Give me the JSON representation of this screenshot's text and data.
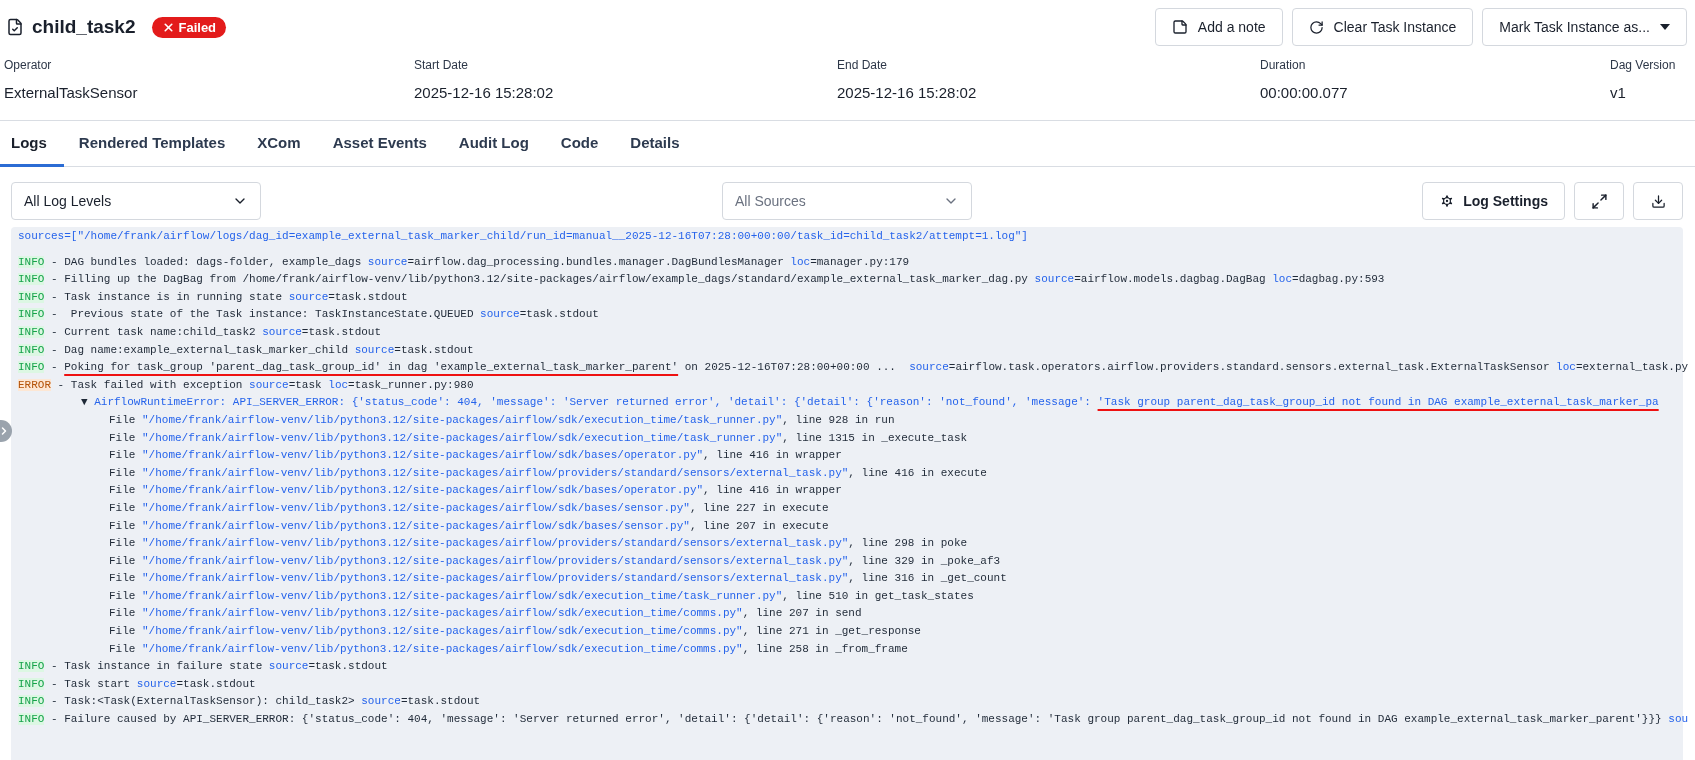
{
  "task": {
    "title": "child_task2",
    "status": {
      "label": "Failed",
      "kind": "failed"
    }
  },
  "actions": [
    {
      "label": "Add a note",
      "kind": "note"
    },
    {
      "label": "Clear Task Instance",
      "kind": "clear"
    },
    {
      "label": "Mark Task Instance as...",
      "kind": "menu"
    }
  ],
  "details": [
    {
      "label": "Operator",
      "value": "ExternalTaskSensor"
    },
    {
      "label": "Start Date",
      "value": "2025-12-16 15:28:02"
    },
    {
      "label": "End Date",
      "value": "2025-12-16 15:28:02"
    },
    {
      "label": "Duration",
      "value": "00:00:00.077"
    },
    {
      "label": "Dag Version",
      "value": "v1"
    }
  ],
  "tabs": [
    {
      "label": "Logs",
      "selected": true
    },
    {
      "label": "Rendered Templates",
      "selected": false
    },
    {
      "label": "XCom",
      "selected": false
    },
    {
      "label": "Asset Events",
      "selected": false
    },
    {
      "label": "Audit Log",
      "selected": false
    },
    {
      "label": "Code",
      "selected": false
    },
    {
      "label": "Details",
      "selected": false
    }
  ],
  "log_toolbar": {
    "level_filter": {
      "value": "All Log Levels"
    },
    "source_filter": {
      "placeholder": "All Sources"
    },
    "buttons": [
      {
        "label": "Log Settings",
        "kind": "settings"
      },
      {
        "kind": "fullscreen"
      },
      {
        "kind": "download"
      }
    ]
  },
  "log": {
    "lines": [
      {
        "kind": "header",
        "segments": [
          {
            "text": "sources=[\"/home/frank/airflow/logs/dag_id=example_external_task_marker_child/run_id=manual__2025-12-16T07:28:00+00:00/task_id=child_task2/attempt=1.log\"]",
            "kind": "link"
          }
        ]
      },
      {
        "kind": "entry",
        "segments": [
          {
            "text": "INFO",
            "kind": "info"
          },
          {
            "text": " - DAG bundles loaded: dags-folder, example_dags ",
            "kind": "plain"
          },
          {
            "text": "source",
            "kind": "link"
          },
          {
            "text": "=airflow.dag_processing.bundles.manager.DagBundlesManager ",
            "kind": "plain"
          },
          {
            "text": "loc",
            "kind": "link"
          },
          {
            "text": "=manager.py:179",
            "kind": "plain"
          }
        ]
      },
      {
        "kind": "entry",
        "segments": [
          {
            "text": "INFO",
            "kind": "info"
          },
          {
            "text": " - Filling up the DagBag from /home/frank/airflow-venv/lib/python3.12/site-packages/airflow/example_dags/standard/example_external_task_marker_dag.py ",
            "kind": "plain"
          },
          {
            "text": "source",
            "kind": "link"
          },
          {
            "text": "=airflow.models.dagbag.DagBag ",
            "kind": "plain"
          },
          {
            "text": "loc",
            "kind": "link"
          },
          {
            "text": "=dagbag.py:593",
            "kind": "plain"
          }
        ]
      },
      {
        "kind": "entry",
        "segments": [
          {
            "text": "INFO",
            "kind": "info"
          },
          {
            "text": " - Task instance is in running state ",
            "kind": "plain"
          },
          {
            "text": "source",
            "kind": "link"
          },
          {
            "text": "=task.stdout",
            "kind": "plain"
          }
        ]
      },
      {
        "kind": "entry",
        "segments": [
          {
            "text": "INFO",
            "kind": "info"
          },
          {
            "text": " -  Previous state of the Task instance: TaskInstanceState.QUEUED ",
            "kind": "plain"
          },
          {
            "text": "source",
            "kind": "link"
          },
          {
            "text": "=task.stdout",
            "kind": "plain"
          }
        ]
      },
      {
        "kind": "entry",
        "segments": [
          {
            "text": "INFO",
            "kind": "info"
          },
          {
            "text": " - Current task name:child_task2 ",
            "kind": "plain"
          },
          {
            "text": "source",
            "kind": "link"
          },
          {
            "text": "=task.stdout",
            "kind": "plain"
          }
        ]
      },
      {
        "kind": "entry",
        "segments": [
          {
            "text": "INFO",
            "kind": "info"
          },
          {
            "text": " - Dag name:example_external_task_marker_child ",
            "kind": "plain"
          },
          {
            "text": "source",
            "kind": "link"
          },
          {
            "text": "=task.stdout",
            "kind": "plain"
          }
        ]
      },
      {
        "kind": "entry",
        "segments": [
          {
            "text": "INFO",
            "kind": "info"
          },
          {
            "text": " - ",
            "kind": "plain"
          },
          {
            "text": "Poking for task_group 'parent_dag_task_group_id' in dag 'example_external_task_marker_parent'",
            "kind": "marked"
          },
          {
            "text": " on 2025-12-16T07:28:00+00:00 ...  ",
            "kind": "plain"
          },
          {
            "text": "source",
            "kind": "link"
          },
          {
            "text": "=airflow.task.operators.airflow.providers.standard.sensors.external_task.ExternalTaskSensor ",
            "kind": "plain"
          },
          {
            "text": "loc",
            "kind": "link"
          },
          {
            "text": "=external_task.py",
            "kind": "plain"
          }
        ]
      },
      {
        "kind": "entry",
        "segments": [
          {
            "text": "ERROR",
            "kind": "error"
          },
          {
            "text": " - Task failed with exception ",
            "kind": "plain"
          },
          {
            "text": "source",
            "kind": "link"
          },
          {
            "text": "=task ",
            "kind": "plain"
          },
          {
            "text": "loc",
            "kind": "link"
          },
          {
            "text": "=task_runner.py:980",
            "kind": "plain"
          }
        ]
      },
      {
        "kind": "exception",
        "segments": [
          {
            "text": "▼ ",
            "kind": "plain"
          },
          {
            "text": "AirflowRuntimeError: API_SERVER_ERROR: {'status_code': 404, 'message': 'Server returned error', 'detail': {'detail': {'reason': 'not_found', 'message': ",
            "kind": "link"
          },
          {
            "text": "'Task group parent_dag_task_group_id not found in DAG example_external_task_marker_pa",
            "kind": "marked-link"
          }
        ]
      },
      {
        "kind": "frame",
        "segments": [
          {
            "text": "File ",
            "kind": "plain"
          },
          {
            "text": "\"/home/frank/airflow-venv/lib/python3.12/site-packages/airflow/sdk/execution_time/task_runner.py\"",
            "kind": "link"
          },
          {
            "text": ", line 928 in run",
            "kind": "plain"
          }
        ]
      },
      {
        "kind": "frame",
        "segments": [
          {
            "text": "File ",
            "kind": "plain"
          },
          {
            "text": "\"/home/frank/airflow-venv/lib/python3.12/site-packages/airflow/sdk/execution_time/task_runner.py\"",
            "kind": "link"
          },
          {
            "text": ", line 1315 in _execute_task",
            "kind": "plain"
          }
        ]
      },
      {
        "kind": "frame",
        "segments": [
          {
            "text": "File ",
            "kind": "plain"
          },
          {
            "text": "\"/home/frank/airflow-venv/lib/python3.12/site-packages/airflow/sdk/bases/operator.py\"",
            "kind": "link"
          },
          {
            "text": ", line 416 in wrapper",
            "kind": "plain"
          }
        ]
      },
      {
        "kind": "frame",
        "segments": [
          {
            "text": "File ",
            "kind": "plain"
          },
          {
            "text": "\"/home/frank/airflow-venv/lib/python3.12/site-packages/airflow/providers/standard/sensors/external_task.py\"",
            "kind": "link"
          },
          {
            "text": ", line 416 in execute",
            "kind": "plain"
          }
        ]
      },
      {
        "kind": "frame",
        "segments": [
          {
            "text": "File ",
            "kind": "plain"
          },
          {
            "text": "\"/home/frank/airflow-venv/lib/python3.12/site-packages/airflow/sdk/bases/operator.py\"",
            "kind": "link"
          },
          {
            "text": ", line 416 in wrapper",
            "kind": "plain"
          }
        ]
      },
      {
        "kind": "frame",
        "segments": [
          {
            "text": "File ",
            "kind": "plain"
          },
          {
            "text": "\"/home/frank/airflow-venv/lib/python3.12/site-packages/airflow/sdk/bases/sensor.py\"",
            "kind": "link"
          },
          {
            "text": ", line 227 in execute",
            "kind": "plain"
          }
        ]
      },
      {
        "kind": "frame",
        "segments": [
          {
            "text": "File ",
            "kind": "plain"
          },
          {
            "text": "\"/home/frank/airflow-venv/lib/python3.12/site-packages/airflow/sdk/bases/sensor.py\"",
            "kind": "link"
          },
          {
            "text": ", line 207 in execute",
            "kind": "plain"
          }
        ]
      },
      {
        "kind": "frame",
        "segments": [
          {
            "text": "File ",
            "kind": "plain"
          },
          {
            "text": "\"/home/frank/airflow-venv/lib/python3.12/site-packages/airflow/providers/standard/sensors/external_task.py\"",
            "kind": "link"
          },
          {
            "text": ", line 298 in poke",
            "kind": "plain"
          }
        ]
      },
      {
        "kind": "frame",
        "segments": [
          {
            "text": "File ",
            "kind": "plain"
          },
          {
            "text": "\"/home/frank/airflow-venv/lib/python3.12/site-packages/airflow/providers/standard/sensors/external_task.py\"",
            "kind": "link"
          },
          {
            "text": ", line 329 in _poke_af3",
            "kind": "plain"
          }
        ]
      },
      {
        "kind": "frame",
        "segments": [
          {
            "text": "File ",
            "kind": "plain"
          },
          {
            "text": "\"/home/frank/airflow-venv/lib/python3.12/site-packages/airflow/providers/standard/sensors/external_task.py\"",
            "kind": "link"
          },
          {
            "text": ", line 316 in _get_count",
            "kind": "plain"
          }
        ]
      },
      {
        "kind": "frame",
        "segments": [
          {
            "text": "File ",
            "kind": "plain"
          },
          {
            "text": "\"/home/frank/airflow-venv/lib/python3.12/site-packages/airflow/sdk/execution_time/task_runner.py\"",
            "kind": "link"
          },
          {
            "text": ", line 510 in get_task_states",
            "kind": "plain"
          }
        ]
      },
      {
        "kind": "frame",
        "segments": [
          {
            "text": "File ",
            "kind": "plain"
          },
          {
            "text": "\"/home/frank/airflow-venv/lib/python3.12/site-packages/airflow/sdk/execution_time/comms.py\"",
            "kind": "link"
          },
          {
            "text": ", line 207 in send",
            "kind": "plain"
          }
        ]
      },
      {
        "kind": "frame",
        "segments": [
          {
            "text": "File ",
            "kind": "plain"
          },
          {
            "text": "\"/home/frank/airflow-venv/lib/python3.12/site-packages/airflow/sdk/execution_time/comms.py\"",
            "kind": "link"
          },
          {
            "text": ", line 271 in _get_response",
            "kind": "plain"
          }
        ]
      },
      {
        "kind": "frame",
        "segments": [
          {
            "text": "File ",
            "kind": "plain"
          },
          {
            "text": "\"/home/frank/airflow-venv/lib/python3.12/site-packages/airflow/sdk/execution_time/comms.py\"",
            "kind": "link"
          },
          {
            "text": ", line 258 in _from_frame",
            "kind": "plain"
          }
        ]
      },
      {
        "kind": "entry",
        "segments": [
          {
            "text": "INFO",
            "kind": "info"
          },
          {
            "text": " - Task instance in failure state ",
            "kind": "plain"
          },
          {
            "text": "source",
            "kind": "link"
          },
          {
            "text": "=task.stdout",
            "kind": "plain"
          }
        ]
      },
      {
        "kind": "entry",
        "segments": [
          {
            "text": "INFO",
            "kind": "info"
          },
          {
            "text": " - Task start ",
            "kind": "plain"
          },
          {
            "text": "source",
            "kind": "link"
          },
          {
            "text": "=task.stdout",
            "kind": "plain"
          }
        ]
      },
      {
        "kind": "entry",
        "segments": [
          {
            "text": "INFO",
            "kind": "info"
          },
          {
            "text": " - Task:<Task(ExternalTaskSensor): child_task2> ",
            "kind": "plain"
          },
          {
            "text": "source",
            "kind": "link"
          },
          {
            "text": "=task.stdout",
            "kind": "plain"
          }
        ]
      },
      {
        "kind": "entry",
        "segments": [
          {
            "text": "INFO",
            "kind": "info"
          },
          {
            "text": " - Failure caused by API_SERVER_ERROR: {'status_code': 404, 'message': 'Server returned error', 'detail': {'detail': {'reason': 'not_found', 'message': 'Task group parent_dag_task_group_id not found in DAG example_external_task_marker_parent'}}} ",
            "kind": "plain"
          },
          {
            "text": "sou",
            "kind": "link"
          }
        ]
      }
    ]
  }
}
